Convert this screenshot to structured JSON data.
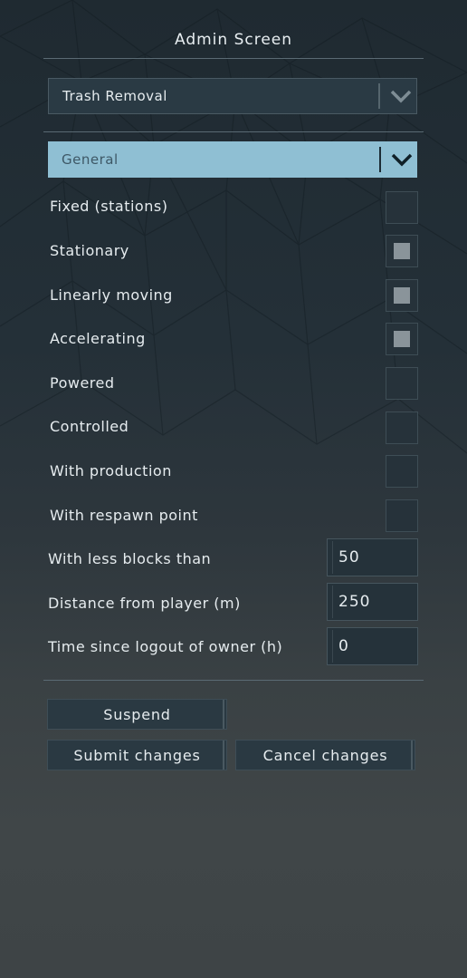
{
  "window": {
    "title": "Admin Screen"
  },
  "mode_select": {
    "value": "Trash Removal"
  },
  "category_select": {
    "value": "General"
  },
  "checkboxes": [
    {
      "label": "Fixed (stations)",
      "checked": false
    },
    {
      "label": "Stationary",
      "checked": true
    },
    {
      "label": "Linearly moving",
      "checked": true
    },
    {
      "label": "Accelerating",
      "checked": true
    },
    {
      "label": "Powered",
      "checked": false
    },
    {
      "label": "Controlled",
      "checked": false
    },
    {
      "label": "With production",
      "checked": false
    },
    {
      "label": "With respawn point",
      "checked": false
    }
  ],
  "fields": [
    {
      "label": "With less blocks than",
      "value": "50"
    },
    {
      "label": "Distance from player (m)",
      "value": "250"
    },
    {
      "label": "Time since logout of owner (h)",
      "value": "0"
    }
  ],
  "buttons": {
    "suspend": "Suspend",
    "submit": "Submit changes",
    "cancel": "Cancel changes"
  },
  "icons": {
    "dropdown": "chevron-down-icon"
  }
}
